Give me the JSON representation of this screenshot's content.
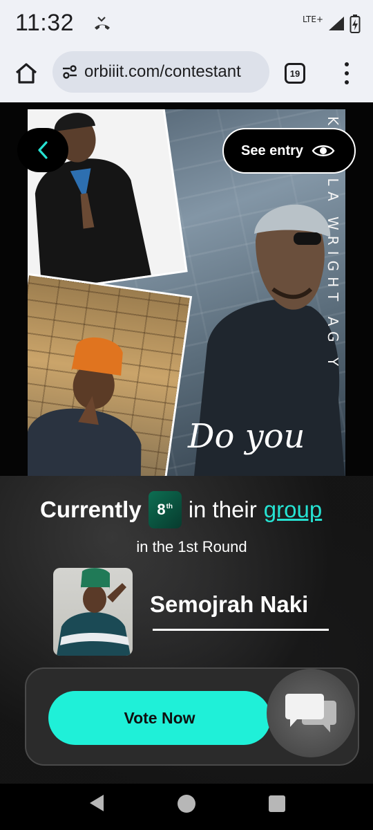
{
  "status_bar": {
    "time": "11:32",
    "network": "LTE+",
    "icons": [
      "missed-call-icon",
      "signal-icon",
      "battery-charging-icon"
    ]
  },
  "browser": {
    "url": "orbiiit.com/contestant",
    "tab_count": "19",
    "icons": [
      "home-icon",
      "site-settings-icon",
      "tabs-icon",
      "more-menu-icon"
    ]
  },
  "poster": {
    "vertical_text": "KAMALA WRIGHT AG Y",
    "script_text": "Do you"
  },
  "entry": {
    "see_entry_label": "See entry"
  },
  "ranking": {
    "prefix": "Currently",
    "rank_number": "8",
    "rank_suffix": "th",
    "middle": "in their",
    "group_link": "group",
    "round_text": "in the 1st Round"
  },
  "contestant": {
    "name": "Semojrah Naki"
  },
  "actions": {
    "vote_label": "Vote Now"
  },
  "colors": {
    "accent": "#1ff0d8",
    "link": "#26e2d2",
    "badge": "#0d6e52",
    "background": "#050505"
  }
}
